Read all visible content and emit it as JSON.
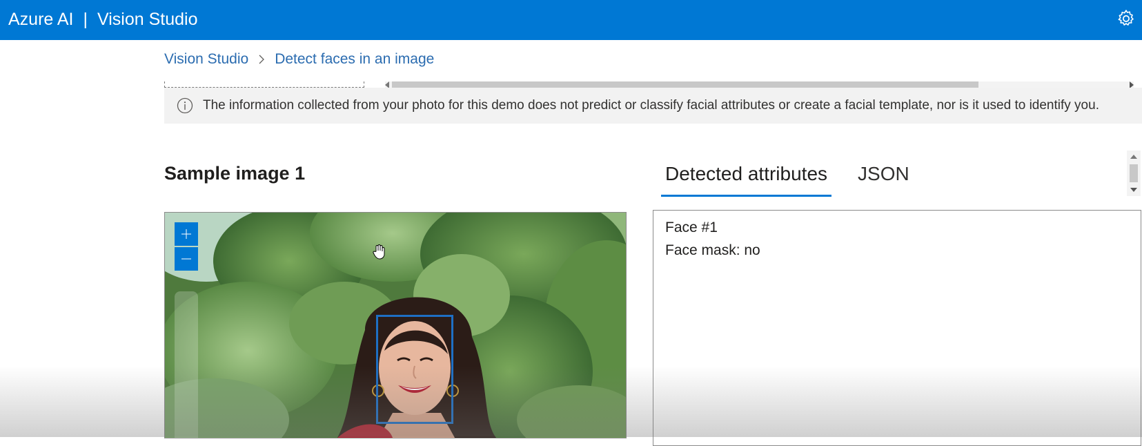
{
  "header": {
    "brand": "Azure AI",
    "separator": "|",
    "product": "Vision Studio",
    "settings_icon": "gear-icon"
  },
  "breadcrumb": {
    "root": "Vision Studio",
    "current": "Detect faces in an image",
    "separator_icon": "chevron-right-icon"
  },
  "notice": {
    "icon": "info-icon",
    "text": "The information collected from your photo for this demo does not predict or classify facial attributes or create a facial template, nor is it used to identify you."
  },
  "sample": {
    "title": "Sample image 1",
    "zoom_in_icon": "plus-icon",
    "zoom_out_icon": "minus-icon"
  },
  "tabs": [
    {
      "label": "Detected attributes",
      "active": true
    },
    {
      "label": "JSON",
      "active": false
    }
  ],
  "results": {
    "lines": [
      "Face #1",
      "Face mask: no"
    ]
  },
  "colors": {
    "accent": "#0078d4",
    "face_box": "#1e6fc4",
    "notice_bg": "#f2f2f2"
  }
}
